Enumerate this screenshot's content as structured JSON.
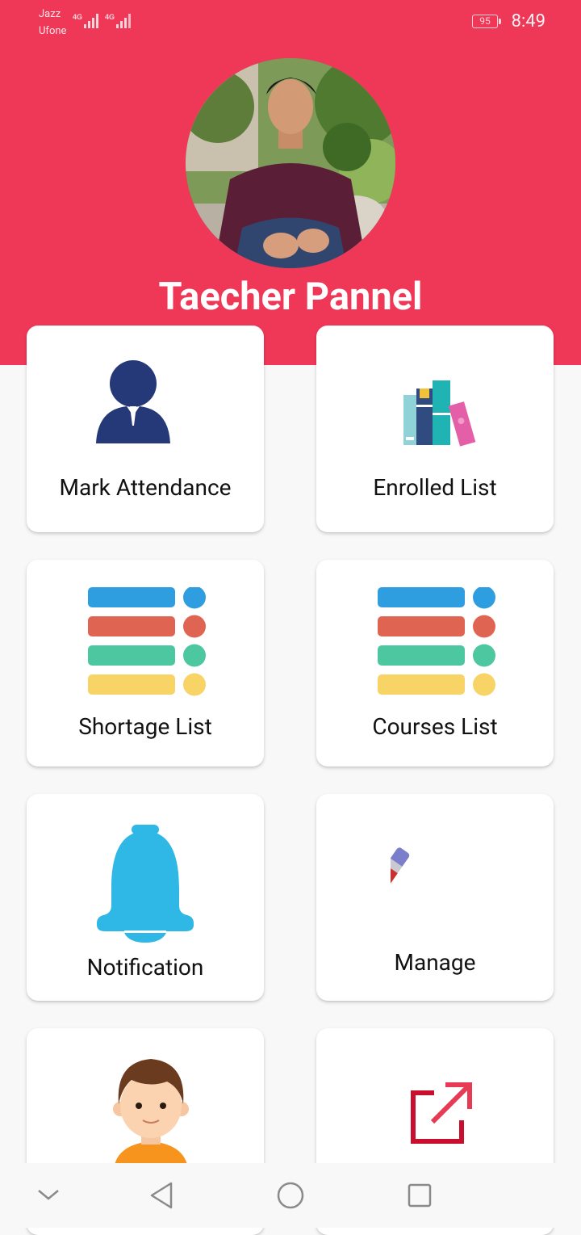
{
  "status_bar": {
    "carrier_1": "Jazz",
    "carrier_2": "Ufone",
    "network_1": "4G",
    "network_2": "4G",
    "battery": "95",
    "time": "8:49"
  },
  "header": {
    "title": "Taecher Pannel",
    "background_color": "#ef3857"
  },
  "menu": [
    {
      "label": "Mark Attendance",
      "icon": "teacher-person-icon"
    },
    {
      "label": "Enrolled List",
      "icon": "books-icon"
    },
    {
      "label": "Shortage List",
      "icon": "colored-list-icon"
    },
    {
      "label": "Courses List",
      "icon": "colored-list-icon"
    },
    {
      "label": "Notification",
      "icon": "bell-icon"
    },
    {
      "label": "Manage",
      "icon": "pencil-icon"
    },
    {
      "label": "",
      "icon": "boy-avatar-icon"
    },
    {
      "label": "",
      "icon": "external-link-icon"
    }
  ],
  "nav_bar": {
    "icons": [
      "collapse-chevron-icon",
      "back-icon",
      "home-icon",
      "recents-icon"
    ]
  }
}
